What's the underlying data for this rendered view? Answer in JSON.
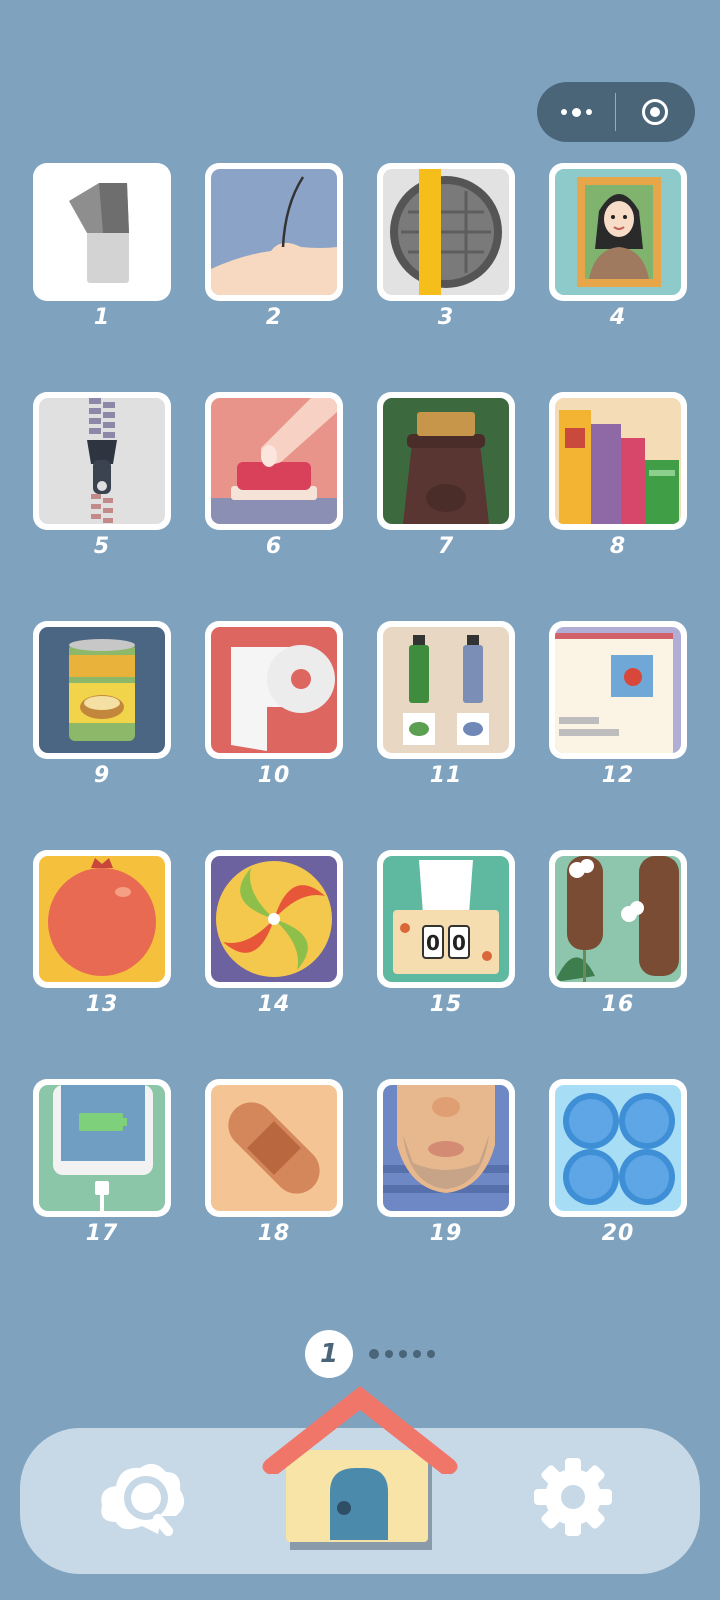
{
  "capsule": {
    "more_icon": "more-dots-icon",
    "close_icon": "target-circle-icon"
  },
  "levels": [
    {
      "number": "1",
      "icon": "light-switch-icon"
    },
    {
      "number": "2",
      "icon": "arm-hair-icon"
    },
    {
      "number": "3",
      "icon": "manhole-cover-icon"
    },
    {
      "number": "4",
      "icon": "portrait-frame-icon"
    },
    {
      "number": "5",
      "icon": "zipper-icon"
    },
    {
      "number": "6",
      "icon": "push-button-icon"
    },
    {
      "number": "7",
      "icon": "cork-bottle-icon"
    },
    {
      "number": "8",
      "icon": "books-icon"
    },
    {
      "number": "9",
      "icon": "food-can-icon"
    },
    {
      "number": "10",
      "icon": "toilet-paper-icon"
    },
    {
      "number": "11",
      "icon": "paint-tubes-icon"
    },
    {
      "number": "12",
      "icon": "envelope-stamp-icon"
    },
    {
      "number": "13",
      "icon": "pomegranate-icon"
    },
    {
      "number": "14",
      "icon": "swirl-candy-icon"
    },
    {
      "number": "15",
      "icon": "tissue-box-icon"
    },
    {
      "number": "16",
      "icon": "cattail-icon"
    },
    {
      "number": "17",
      "icon": "charging-phone-icon"
    },
    {
      "number": "18",
      "icon": "bandage-icon"
    },
    {
      "number": "19",
      "icon": "beard-face-icon"
    },
    {
      "number": "20",
      "icon": "bubble-wrap-icon"
    }
  ],
  "tile_digits": [
    "0",
    "0"
  ],
  "pager": {
    "current": "1",
    "total_pages": 6
  },
  "bottom_bar": {
    "left_icon": "hint-magnifier-icon",
    "center_icon": "home-house-icon",
    "right_icon": "settings-gear-icon"
  }
}
